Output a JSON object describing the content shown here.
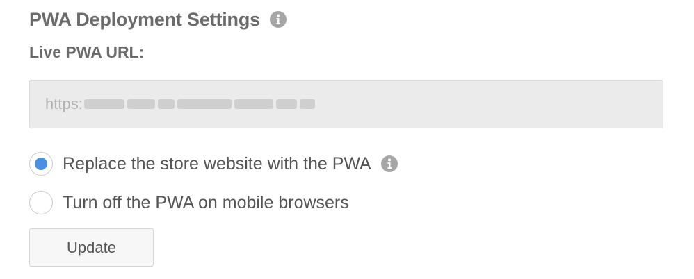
{
  "section": {
    "title": "PWA Deployment Settings",
    "title_icon": "info-icon"
  },
  "live_url": {
    "label": "Live PWA URL:",
    "value_prefix": "https:"
  },
  "deployment_options": [
    {
      "label": "Replace the store website with the PWA",
      "selected": true,
      "icon": "info-icon"
    },
    {
      "label": "Turn off the PWA on mobile browsers",
      "selected": false
    }
  ],
  "actions": {
    "update_label": "Update"
  },
  "colors": {
    "radio_selected": "#4a8fe0",
    "field_background": "#ebebeb",
    "text": "#555555"
  }
}
